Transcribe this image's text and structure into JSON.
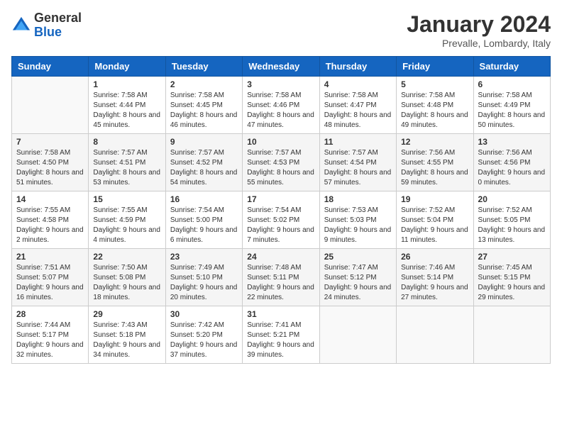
{
  "header": {
    "logo": {
      "general": "General",
      "blue": "Blue"
    },
    "title": "January 2024",
    "location": "Prevalle, Lombardy, Italy"
  },
  "weekdays": [
    "Sunday",
    "Monday",
    "Tuesday",
    "Wednesday",
    "Thursday",
    "Friday",
    "Saturday"
  ],
  "weeks": [
    [
      {
        "day": "",
        "sunrise": "",
        "sunset": "",
        "daylight": ""
      },
      {
        "day": "1",
        "sunrise": "Sunrise: 7:58 AM",
        "sunset": "Sunset: 4:44 PM",
        "daylight": "Daylight: 8 hours and 45 minutes."
      },
      {
        "day": "2",
        "sunrise": "Sunrise: 7:58 AM",
        "sunset": "Sunset: 4:45 PM",
        "daylight": "Daylight: 8 hours and 46 minutes."
      },
      {
        "day": "3",
        "sunrise": "Sunrise: 7:58 AM",
        "sunset": "Sunset: 4:46 PM",
        "daylight": "Daylight: 8 hours and 47 minutes."
      },
      {
        "day": "4",
        "sunrise": "Sunrise: 7:58 AM",
        "sunset": "Sunset: 4:47 PM",
        "daylight": "Daylight: 8 hours and 48 minutes."
      },
      {
        "day": "5",
        "sunrise": "Sunrise: 7:58 AM",
        "sunset": "Sunset: 4:48 PM",
        "daylight": "Daylight: 8 hours and 49 minutes."
      },
      {
        "day": "6",
        "sunrise": "Sunrise: 7:58 AM",
        "sunset": "Sunset: 4:49 PM",
        "daylight": "Daylight: 8 hours and 50 minutes."
      }
    ],
    [
      {
        "day": "7",
        "sunrise": "Sunrise: 7:58 AM",
        "sunset": "Sunset: 4:50 PM",
        "daylight": "Daylight: 8 hours and 51 minutes."
      },
      {
        "day": "8",
        "sunrise": "Sunrise: 7:57 AM",
        "sunset": "Sunset: 4:51 PM",
        "daylight": "Daylight: 8 hours and 53 minutes."
      },
      {
        "day": "9",
        "sunrise": "Sunrise: 7:57 AM",
        "sunset": "Sunset: 4:52 PM",
        "daylight": "Daylight: 8 hours and 54 minutes."
      },
      {
        "day": "10",
        "sunrise": "Sunrise: 7:57 AM",
        "sunset": "Sunset: 4:53 PM",
        "daylight": "Daylight: 8 hours and 55 minutes."
      },
      {
        "day": "11",
        "sunrise": "Sunrise: 7:57 AM",
        "sunset": "Sunset: 4:54 PM",
        "daylight": "Daylight: 8 hours and 57 minutes."
      },
      {
        "day": "12",
        "sunrise": "Sunrise: 7:56 AM",
        "sunset": "Sunset: 4:55 PM",
        "daylight": "Daylight: 8 hours and 59 minutes."
      },
      {
        "day": "13",
        "sunrise": "Sunrise: 7:56 AM",
        "sunset": "Sunset: 4:56 PM",
        "daylight": "Daylight: 9 hours and 0 minutes."
      }
    ],
    [
      {
        "day": "14",
        "sunrise": "Sunrise: 7:55 AM",
        "sunset": "Sunset: 4:58 PM",
        "daylight": "Daylight: 9 hours and 2 minutes."
      },
      {
        "day": "15",
        "sunrise": "Sunrise: 7:55 AM",
        "sunset": "Sunset: 4:59 PM",
        "daylight": "Daylight: 9 hours and 4 minutes."
      },
      {
        "day": "16",
        "sunrise": "Sunrise: 7:54 AM",
        "sunset": "Sunset: 5:00 PM",
        "daylight": "Daylight: 9 hours and 6 minutes."
      },
      {
        "day": "17",
        "sunrise": "Sunrise: 7:54 AM",
        "sunset": "Sunset: 5:02 PM",
        "daylight": "Daylight: 9 hours and 7 minutes."
      },
      {
        "day": "18",
        "sunrise": "Sunrise: 7:53 AM",
        "sunset": "Sunset: 5:03 PM",
        "daylight": "Daylight: 9 hours and 9 minutes."
      },
      {
        "day": "19",
        "sunrise": "Sunrise: 7:52 AM",
        "sunset": "Sunset: 5:04 PM",
        "daylight": "Daylight: 9 hours and 11 minutes."
      },
      {
        "day": "20",
        "sunrise": "Sunrise: 7:52 AM",
        "sunset": "Sunset: 5:05 PM",
        "daylight": "Daylight: 9 hours and 13 minutes."
      }
    ],
    [
      {
        "day": "21",
        "sunrise": "Sunrise: 7:51 AM",
        "sunset": "Sunset: 5:07 PM",
        "daylight": "Daylight: 9 hours and 16 minutes."
      },
      {
        "day": "22",
        "sunrise": "Sunrise: 7:50 AM",
        "sunset": "Sunset: 5:08 PM",
        "daylight": "Daylight: 9 hours and 18 minutes."
      },
      {
        "day": "23",
        "sunrise": "Sunrise: 7:49 AM",
        "sunset": "Sunset: 5:10 PM",
        "daylight": "Daylight: 9 hours and 20 minutes."
      },
      {
        "day": "24",
        "sunrise": "Sunrise: 7:48 AM",
        "sunset": "Sunset: 5:11 PM",
        "daylight": "Daylight: 9 hours and 22 minutes."
      },
      {
        "day": "25",
        "sunrise": "Sunrise: 7:47 AM",
        "sunset": "Sunset: 5:12 PM",
        "daylight": "Daylight: 9 hours and 24 minutes."
      },
      {
        "day": "26",
        "sunrise": "Sunrise: 7:46 AM",
        "sunset": "Sunset: 5:14 PM",
        "daylight": "Daylight: 9 hours and 27 minutes."
      },
      {
        "day": "27",
        "sunrise": "Sunrise: 7:45 AM",
        "sunset": "Sunset: 5:15 PM",
        "daylight": "Daylight: 9 hours and 29 minutes."
      }
    ],
    [
      {
        "day": "28",
        "sunrise": "Sunrise: 7:44 AM",
        "sunset": "Sunset: 5:17 PM",
        "daylight": "Daylight: 9 hours and 32 minutes."
      },
      {
        "day": "29",
        "sunrise": "Sunrise: 7:43 AM",
        "sunset": "Sunset: 5:18 PM",
        "daylight": "Daylight: 9 hours and 34 minutes."
      },
      {
        "day": "30",
        "sunrise": "Sunrise: 7:42 AM",
        "sunset": "Sunset: 5:20 PM",
        "daylight": "Daylight: 9 hours and 37 minutes."
      },
      {
        "day": "31",
        "sunrise": "Sunrise: 7:41 AM",
        "sunset": "Sunset: 5:21 PM",
        "daylight": "Daylight: 9 hours and 39 minutes."
      },
      {
        "day": "",
        "sunrise": "",
        "sunset": "",
        "daylight": ""
      },
      {
        "day": "",
        "sunrise": "",
        "sunset": "",
        "daylight": ""
      },
      {
        "day": "",
        "sunrise": "",
        "sunset": "",
        "daylight": ""
      }
    ]
  ]
}
